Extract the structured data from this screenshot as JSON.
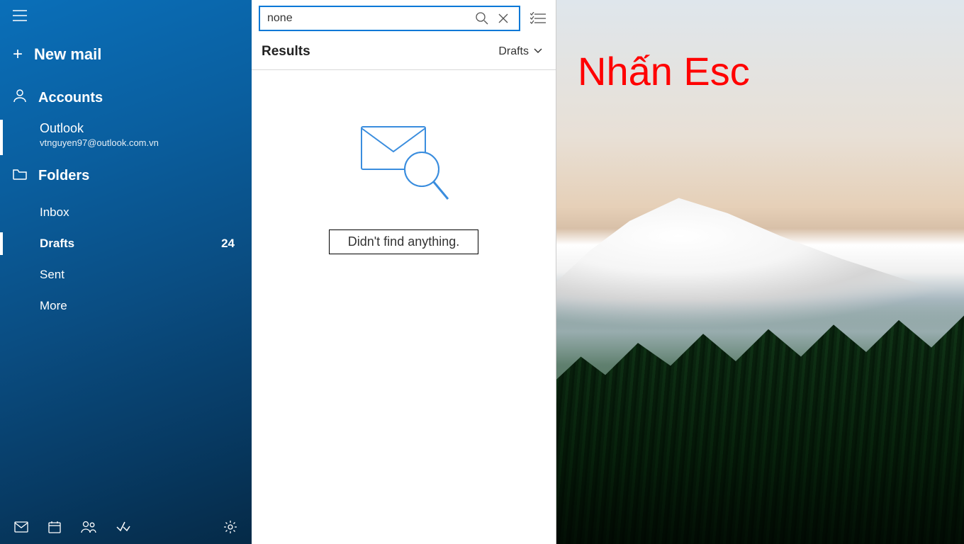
{
  "sidebar": {
    "new_mail_label": "New mail",
    "accounts_header": "Accounts",
    "account": {
      "name": "Outlook",
      "email": "vtnguyen97@outlook.com.vn"
    },
    "folders_header": "Folders",
    "folders": [
      {
        "label": "Inbox",
        "count": ""
      },
      {
        "label": "Drafts",
        "count": "24"
      },
      {
        "label": "Sent",
        "count": ""
      },
      {
        "label": "More",
        "count": ""
      }
    ]
  },
  "search": {
    "value": "none",
    "placeholder": "Search"
  },
  "results": {
    "header": "Results",
    "filter_label": "Drafts",
    "empty_message": "Didn't find anything."
  },
  "overlay": {
    "text": "Nhấn Esc"
  },
  "colors": {
    "accent": "#0078d7",
    "overlay_text": "#ff0000"
  }
}
